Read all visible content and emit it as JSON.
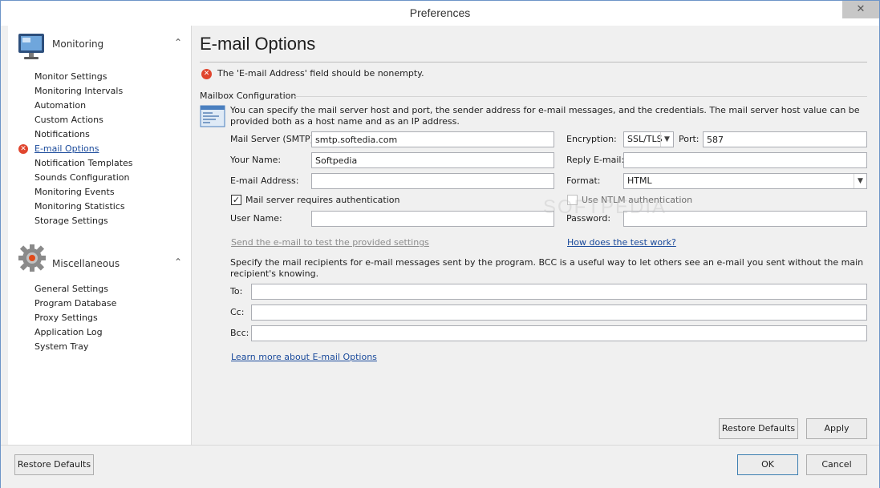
{
  "window": {
    "title": "Preferences",
    "close_glyph": "✕"
  },
  "sidebar": {
    "categories": [
      {
        "label": "Monitoring",
        "icon": "monitor-icon",
        "items": [
          {
            "label": "Monitor Settings"
          },
          {
            "label": "Monitoring Intervals"
          },
          {
            "label": "Automation"
          },
          {
            "label": "Custom Actions"
          },
          {
            "label": "Notifications"
          },
          {
            "label": "E-mail Options",
            "active": true,
            "error": true
          },
          {
            "label": "Notification Templates"
          },
          {
            "label": "Sounds Configuration"
          },
          {
            "label": "Monitoring Events"
          },
          {
            "label": "Monitoring Statistics"
          },
          {
            "label": "Storage Settings"
          }
        ]
      },
      {
        "label": "Miscellaneous",
        "icon": "gear-icon",
        "items": [
          {
            "label": "General Settings"
          },
          {
            "label": "Program Database"
          },
          {
            "label": "Proxy Settings"
          },
          {
            "label": "Application Log"
          },
          {
            "label": "System Tray"
          }
        ]
      }
    ],
    "chevron_glyph": "⌃"
  },
  "main": {
    "title": "E-mail Options",
    "error_message": "The 'E-mail Address' field should be nonempty.",
    "group_label": "Mailbox Configuration",
    "description": "You can specify the mail server host and port, the sender address for e-mail messages, and the credentials. The mail server host value can be provided both as a host name and as an IP address.",
    "fields": {
      "mail_server_label": "Mail Server (SMTP):",
      "mail_server_value": "smtp.softedia.com",
      "your_name_label": "Your Name:",
      "your_name_value": "Softpedia",
      "email_address_label": "E-mail Address:",
      "email_address_value": "",
      "encryption_label": "Encryption:",
      "encryption_value": "SSL/TLS",
      "port_label": "Port:",
      "port_value": "587",
      "reply_email_label": "Reply E-mail:",
      "reply_email_value": "",
      "format_label": "Format:",
      "format_value": "HTML",
      "auth_checkbox_label": "Mail server requires authentication",
      "auth_checked": true,
      "ntlm_checkbox_label": "Use NTLM authentication",
      "ntlm_checked": false,
      "user_name_label": "User Name:",
      "user_name_value": "",
      "password_label": "Password:",
      "password_value": ""
    },
    "test_link": "Send the e-mail to test the provided settings",
    "how_link": "How does the test work?",
    "recipients_description": "Specify the mail recipients for e-mail messages sent by the program. BCC is a useful way to let others see an e-mail you sent without the main recipient's knowing.",
    "recipients": {
      "to_label": "To:",
      "to_value": "",
      "cc_label": "Cc:",
      "cc_value": "",
      "bcc_label": "Bcc:",
      "bcc_value": ""
    },
    "learn_more_link": "Learn more about E-mail Options",
    "restore_defaults_label": "Restore Defaults",
    "apply_label": "Apply"
  },
  "footer": {
    "restore_defaults_label": "Restore Defaults",
    "ok_label": "OK",
    "cancel_label": "Cancel"
  },
  "watermark": "SOFTPEDIA",
  "colors": {
    "error": "#e0452e",
    "link": "#1a4a9b",
    "accent_border": "#3c7fb1"
  }
}
